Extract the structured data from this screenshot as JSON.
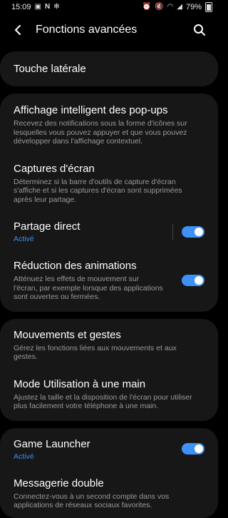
{
  "status": {
    "time": "15:09",
    "battery": "79%"
  },
  "appbar": {
    "title": "Fonctions avancées"
  },
  "cards": {
    "c1": {
      "side_key": {
        "title": "Touche latérale"
      }
    },
    "c2": {
      "smart_popup": {
        "title": "Affichage intelligent des pop-ups",
        "desc": "Recevez des notifications sous la forme d'icônes sur lesquelles vous pouvez appuyer et que vous pouvez développer dans l'affichage contextuel."
      },
      "screenshots": {
        "title": "Captures d'écran",
        "desc": "Déterminez si la barre d'outils de capture d'écran s'affiche et si les captures d'écran sont supprimées après leur partage."
      },
      "direct_share": {
        "title": "Partage direct",
        "status": "Activé",
        "on": true
      },
      "reduce_animations": {
        "title": "Réduction des animations",
        "desc": "Atténuez les effets de mouvement sur l'écran, par exemple lorsque des applications sont ouvertes ou fermées.",
        "on": true
      }
    },
    "c3": {
      "motions": {
        "title": "Mouvements et gestes",
        "desc": "Gérez les fonctions liées aux mouvements et aux gestes."
      },
      "one_hand": {
        "title": "Mode Utilisation à une main",
        "desc": "Ajustez la taille et la disposition de l'écran pour utiliser plus facilement votre téléphone à une main."
      }
    },
    "c4": {
      "game_launcher": {
        "title": "Game Launcher",
        "status": "Activé",
        "on": true
      },
      "dual_messenger": {
        "title": "Messagerie double",
        "desc": "Connectez-vous à un second compte dans vos applications de réseaux sociaux favorites."
      }
    }
  },
  "colors": {
    "accent": "#3e91f6",
    "card": "#171717",
    "background": "#000000"
  }
}
